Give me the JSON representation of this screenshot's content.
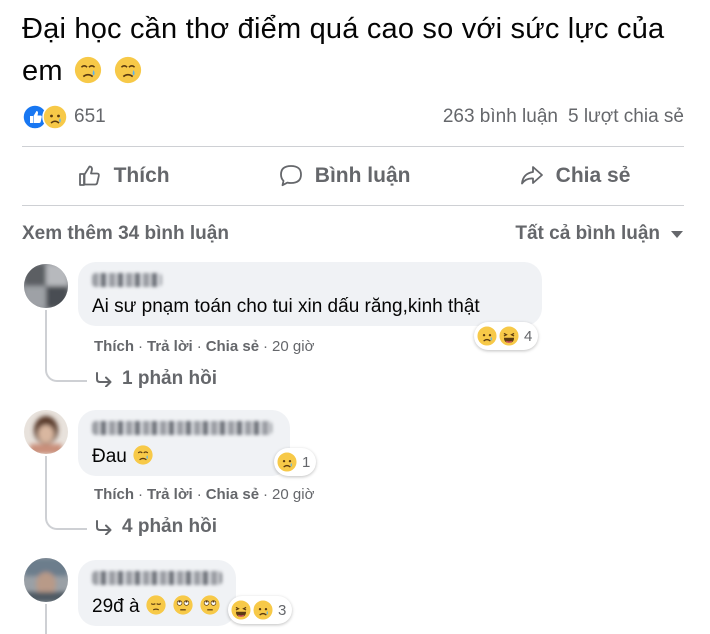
{
  "post": {
    "text": "Đại học cần thơ điểm quá cao so với sức lực của em"
  },
  "stats": {
    "reaction_count": "651",
    "comments": "263 bình luận",
    "shares": "5 lượt chia sẻ"
  },
  "actions": {
    "like": "Thích",
    "comment": "Bình luận",
    "share": "Chia sẻ"
  },
  "comments_header": {
    "more": "Xem thêm 34 bình luận",
    "filter": "Tất cả bình luận"
  },
  "comments": [
    {
      "text": "Ai sư pnạm toán cho tui xin dấu răng,kinh thật",
      "reaction_count": "4",
      "reactions": [
        "sad-icon",
        "haha-icon"
      ],
      "like": "Thích",
      "reply": "Trả lời",
      "share": "Chia sẻ",
      "time": "20 giờ",
      "replies": "1 phản hồi"
    },
    {
      "text": "Đau",
      "reaction_count": "1",
      "reactions": [
        "sad-icon"
      ],
      "like": "Thích",
      "reply": "Trả lời",
      "share": "Chia sẻ",
      "time": "20 giờ",
      "replies": "4 phản hồi"
    },
    {
      "text": "29đ à",
      "reaction_count": "3",
      "reactions": [
        "haha-icon",
        "sad-icon"
      ]
    }
  ],
  "colors": {
    "like_blue": "#1877f2",
    "emoji_yellow": "#f7c948",
    "secondary_text": "#65676b",
    "bubble_bg": "#f0f2f5"
  }
}
